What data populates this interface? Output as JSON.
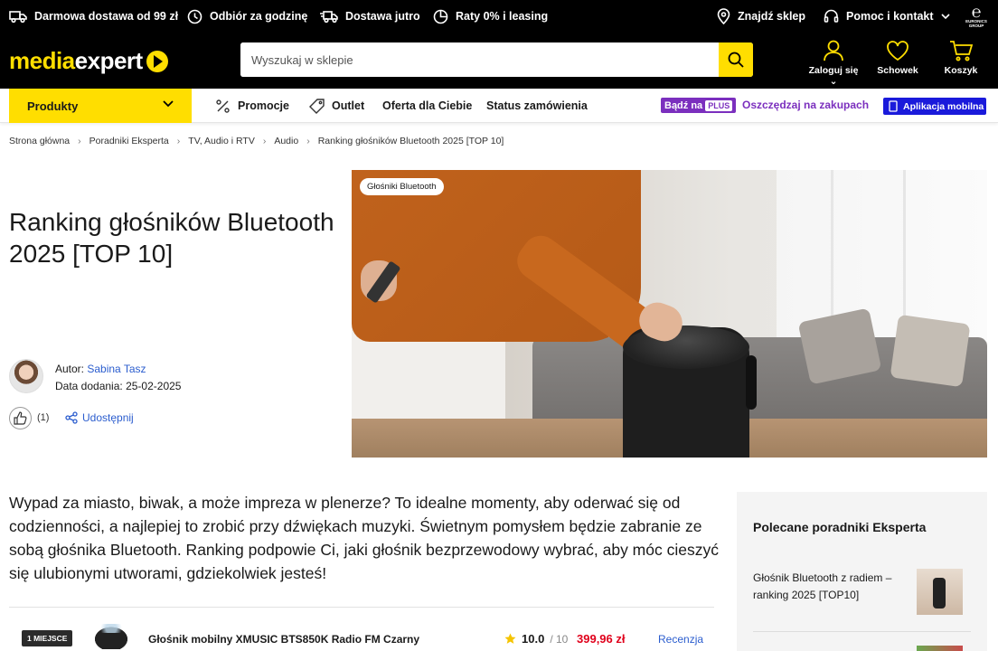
{
  "topbar": {
    "delivery": "Darmowa dostawa od 99 zł",
    "pickup": "Odbiór za godzinę",
    "tomorrow": "Dostawa jutro",
    "installments": "Raty 0% i leasing",
    "find_store": "Znajdź sklep",
    "help": "Pomoc i kontakt",
    "group_logo": "EURONICS GROUP"
  },
  "header": {
    "logo_media": "media",
    "logo_expert": "expert",
    "search_placeholder": "Wyszukaj w sklepie",
    "login": "Zaloguj się",
    "wishlist": "Schowek",
    "cart": "Koszyk",
    "accent": "#ffde00"
  },
  "nav": {
    "products": "Produkty",
    "promotions": "Promocje",
    "outlet": "Outlet",
    "offer": "Oferta dla Ciebie",
    "order_status": "Status zamówienia",
    "plus_prefix": "Bądź na",
    "plus_badge": "PLUS",
    "plus_link": "Oszczędzaj na zakupach",
    "mobile_app": "Aplikacja mobilna"
  },
  "breadcrumb": {
    "items": [
      "Strona główna",
      "Poradniki Eksperta",
      "TV, Audio i RTV",
      "Audio",
      "Ranking głośników Bluetooth 2025 [TOP 10]"
    ]
  },
  "article": {
    "title": "Ranking głośników Bluetooth 2025 [TOP 10]",
    "author_label": "Autor:",
    "author_name": "Sabina Tasz",
    "date_label": "Data dodania:",
    "date": "25-02-2025",
    "likes": "(1)",
    "share": "Udostępnij",
    "hero_tag": "Głośniki Bluetooth",
    "intro": "Wypad za miasto, biwak, a może impreza w plenerze? To idealne momenty, aby oderwać się od codzienności, a najlepiej to zrobić przy dźwiękach muzyki. Świetnym pomysłem będzie zabranie ze sobą głośnika Bluetooth. Ranking podpowie Ci, jaki głośnik bezprzewodowy wybrać, aby móc cieszyć się ulubionymi utworami, gdziekolwiek jesteś!"
  },
  "ranking": {
    "place": "1 MIEJSCE",
    "product_name": "Głośnik mobilny XMUSIC BTS850K Radio FM Czarny",
    "score": "10.0",
    "score_max": "/ 10",
    "price": "399,96 zł",
    "review": "Recenzja"
  },
  "sidebar": {
    "title": "Polecane poradniki Eksperta",
    "link1": "Głośnik Bluetooth z radiem – ranking 2025 [TOP10]"
  }
}
